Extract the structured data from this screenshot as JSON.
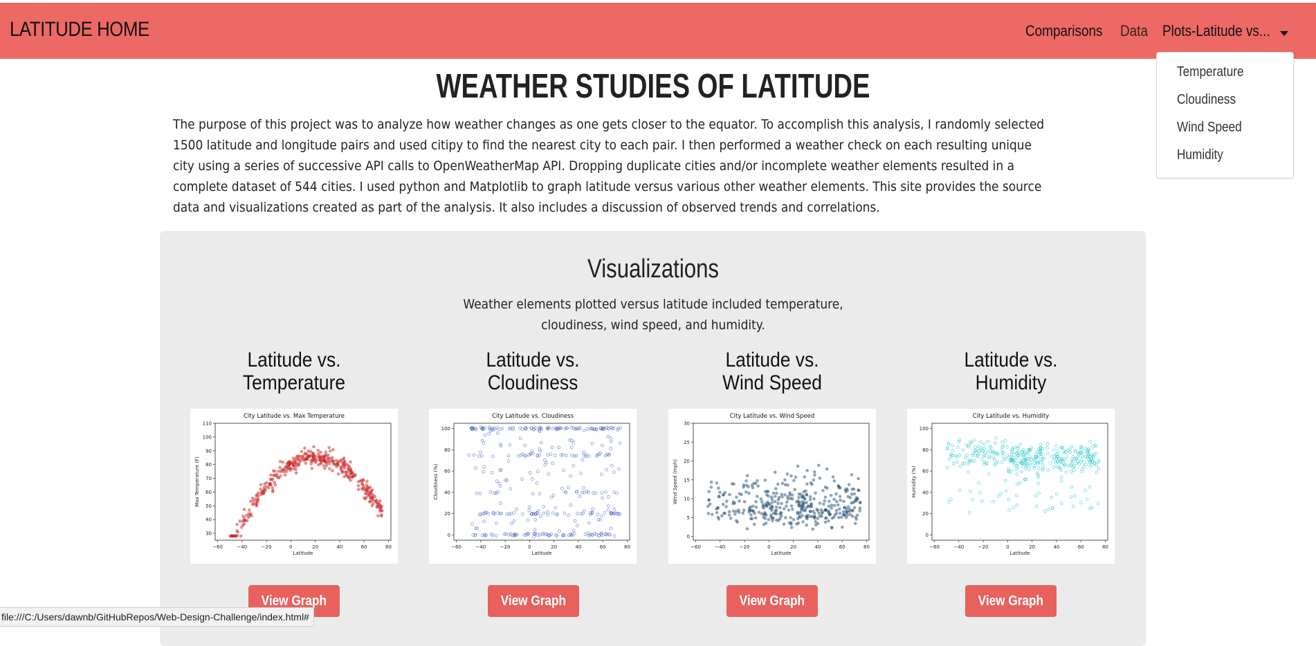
{
  "navbar": {
    "brand": "LATITUDE HOME",
    "links": [
      {
        "label": "Comparisons"
      },
      {
        "label": "Data"
      },
      {
        "label": "Plots-Latitude vs..."
      }
    ],
    "dropdown": [
      "Temperature",
      "Cloudiness",
      "Wind Speed",
      "Humidity"
    ],
    "bg_color": "#ec6966"
  },
  "main": {
    "title": "WEATHER STUDIES OF LATITUDE",
    "intro": "The purpose of this project was to analyze how weather changes as one gets closer to the equator. To accomplish this analysis, I randomly selected 1500 latitude and longitude pairs and used citipy to find the nearest city to each pair. I then performed a weather check on each resulting unique city using a series of successive API calls to OpenWeatherMap API. Dropping duplicate cities and/or incomplete weather elements resulted in a complete dataset of 544 cities. I used python and Matplotlib to graph latitude versus various other weather elements. This site provides the source data and visualizations created as part of the analysis. It also includes a discussion of observed trends and correlations."
  },
  "visualizations": {
    "title": "Visualizations",
    "subtitle": "Weather elements plotted versus latitude included temperature, cloudiness, wind speed, and humidity.",
    "button_label": "View Graph",
    "cards": [
      {
        "title_line1": "Latitude vs.",
        "title_line2": "Temperature",
        "plot_title": "City Latitude vs. Max Temperature",
        "ylabel": "Max Temperature (F)",
        "xlabel": "Latitude",
        "yticks": [
          "30",
          "40",
          "50",
          "60",
          "70",
          "80",
          "90",
          "100",
          "110"
        ],
        "ymin": 25,
        "ymax": 110,
        "color": "#cc2a2a",
        "kind": "temp"
      },
      {
        "title_line1": "Latitude vs.",
        "title_line2": "Cloudiness",
        "plot_title": "City Latitude vs. Cloudiness",
        "ylabel": "Cloudiness (%)",
        "xlabel": "Latitude",
        "yticks": [
          "0",
          "20",
          "40",
          "60",
          "80",
          "100"
        ],
        "ymin": -5,
        "ymax": 105,
        "color": "#3c5bbf",
        "kind": "cloud"
      },
      {
        "title_line1": "Latitude vs.",
        "title_line2": "Wind Speed",
        "plot_title": "City Latitude vs. Wind Speed",
        "ylabel": "Wind Speed (mph)",
        "xlabel": "Latitude",
        "yticks": [
          "0",
          "5",
          "10",
          "15",
          "20",
          "25",
          "30"
        ],
        "ymin": -1,
        "ymax": 30,
        "color": "#2c5478",
        "kind": "wind"
      },
      {
        "title_line1": "Latitude vs.",
        "title_line2": "Humidity",
        "plot_title": "City Latitude vs. Humidity",
        "ylabel": "Humidity (%)",
        "xlabel": "Latitude",
        "yticks": [
          "0",
          "20",
          "40",
          "60",
          "80",
          "100"
        ],
        "ymin": -5,
        "ymax": 105,
        "color": "#1cc4c4",
        "kind": "hum"
      }
    ],
    "xticks": [
      "−60",
      "−40",
      "−20",
      "0",
      "20",
      "40",
      "60",
      "80"
    ],
    "xmin": -62,
    "xmax": 82
  },
  "status_bar": "file:///C:/Users/dawnb/GitHubRepos/Web-Design-Challenge/index.html#"
}
